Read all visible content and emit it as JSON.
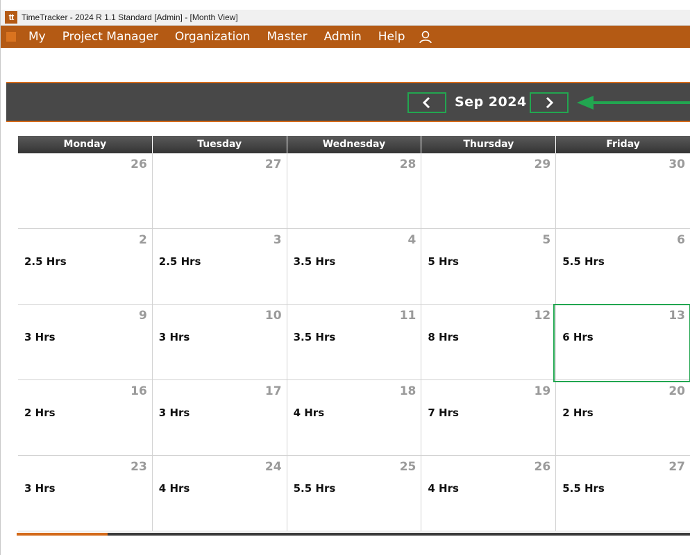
{
  "window": {
    "logo_text": "tt",
    "title": "TimeTracker - 2024 R 1.1 Standard [Admin] - [Month View]"
  },
  "menu": {
    "items": [
      "My",
      "Project Manager",
      "Organization",
      "Master",
      "Admin",
      "Help"
    ],
    "user_icon": "user-icon"
  },
  "nav": {
    "month_label": "Sep 2024",
    "prev_icon": "chevron-left-icon",
    "next_icon": "chevron-right-icon"
  },
  "calendar": {
    "days_of_week": [
      "Monday",
      "Tuesday",
      "Wednesday",
      "Thursday",
      "Friday"
    ],
    "weeks": [
      [
        {
          "day": "26",
          "hours": ""
        },
        {
          "day": "27",
          "hours": ""
        },
        {
          "day": "28",
          "hours": ""
        },
        {
          "day": "29",
          "hours": ""
        },
        {
          "day": "30",
          "hours": ""
        }
      ],
      [
        {
          "day": "2",
          "hours": "2.5 Hrs"
        },
        {
          "day": "3",
          "hours": "2.5 Hrs"
        },
        {
          "day": "4",
          "hours": "3.5 Hrs"
        },
        {
          "day": "5",
          "hours": "5 Hrs"
        },
        {
          "day": "6",
          "hours": "5.5 Hrs"
        }
      ],
      [
        {
          "day": "9",
          "hours": "3 Hrs"
        },
        {
          "day": "10",
          "hours": "3 Hrs"
        },
        {
          "day": "11",
          "hours": "3.5 Hrs"
        },
        {
          "day": "12",
          "hours": "8 Hrs"
        },
        {
          "day": "13",
          "hours": "6 Hrs"
        }
      ],
      [
        {
          "day": "16",
          "hours": "2 Hrs"
        },
        {
          "day": "17",
          "hours": "3 Hrs"
        },
        {
          "day": "18",
          "hours": "4 Hrs"
        },
        {
          "day": "19",
          "hours": "7 Hrs"
        },
        {
          "day": "20",
          "hours": "2 Hrs"
        }
      ],
      [
        {
          "day": "23",
          "hours": "3 Hrs"
        },
        {
          "day": "24",
          "hours": "4 Hrs"
        },
        {
          "day": "25",
          "hours": "5.5 Hrs"
        },
        {
          "day": "26",
          "hours": "4 Hrs"
        },
        {
          "day": "27",
          "hours": "5.5 Hrs"
        }
      ]
    ]
  },
  "progress": {
    "fraction": 0.135
  },
  "colors": {
    "brand": "#b45a14",
    "accent": "#d36a1a",
    "highlight": "#22a650"
  }
}
